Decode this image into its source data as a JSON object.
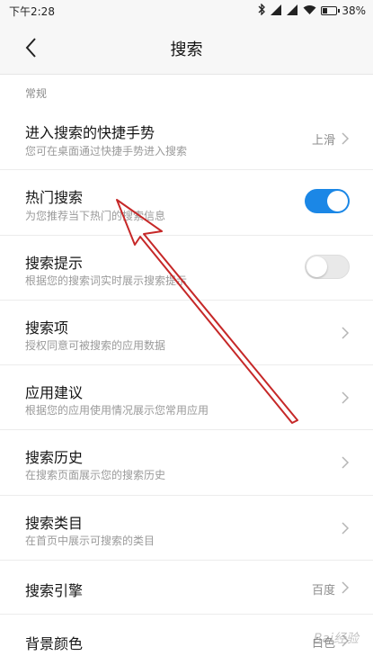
{
  "status_bar": {
    "time": "下午2:28",
    "battery_percent": "38%",
    "battery_level": 0.38
  },
  "header": {
    "title": "搜索",
    "back_icon": "chevron-left-icon"
  },
  "section": {
    "label": "常规"
  },
  "settings": [
    {
      "id": "gesture",
      "title": "进入搜索的快捷手势",
      "subtitle": "您可在桌面通过快捷手势进入搜索",
      "value": "上滑",
      "control": "chevron"
    },
    {
      "id": "hot",
      "title": "热门搜索",
      "subtitle": "为您推荐当下热门的搜索信息",
      "control": "toggle",
      "enabled": true
    },
    {
      "id": "hint",
      "title": "搜索提示",
      "subtitle": "根据您的搜索词实时展示搜索提示",
      "control": "toggle",
      "enabled": false
    },
    {
      "id": "items",
      "title": "搜索项",
      "subtitle": "授权同意可被搜索的应用数据",
      "control": "chevron"
    },
    {
      "id": "suggest",
      "title": "应用建议",
      "subtitle": "根据您的应用使用情况展示您常用应用",
      "control": "chevron"
    },
    {
      "id": "history",
      "title": "搜索历史",
      "subtitle": "在搜索页面展示您的搜索历史",
      "control": "chevron"
    },
    {
      "id": "category",
      "title": "搜索类目",
      "subtitle": "在首页中展示可搜索的类目",
      "control": "chevron"
    },
    {
      "id": "engine",
      "title": "搜索引擎",
      "value": "百度",
      "control": "chevron"
    },
    {
      "id": "bgcolor",
      "title": "背景颜色",
      "value": "白色",
      "control": "chevron"
    }
  ],
  "colors": {
    "toggle_on": "#1b87e6",
    "annotation_arrow": "#c62828"
  },
  "watermark": "Bai经验"
}
